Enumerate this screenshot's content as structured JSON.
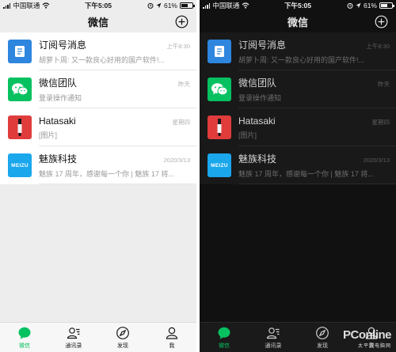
{
  "status": {
    "carrier": "中国联通",
    "time": "下午5:05",
    "battery": "61%",
    "battery_level": 0.61
  },
  "header": {
    "title": "微信"
  },
  "chats": [
    {
      "name": "订阅号消息",
      "preview": "胡萝卜周: 又一款良心好用的国产软件!...",
      "time": "上午8:30",
      "avatar": "subscription-icon",
      "color": "#2e86de"
    },
    {
      "name": "微信团队",
      "preview": "登录操作通知",
      "time": "昨天",
      "avatar": "wechat-icon",
      "color": "#07c160"
    },
    {
      "name": "Hatasaki",
      "preview": "[图片]",
      "time": "星期四",
      "avatar": "hatasaki-avatar",
      "color": "#e03c3c"
    },
    {
      "name": "魅族科技",
      "preview": "魅族 17 周年，感谢每一个你 | 魅族 17 将...",
      "time": "2020/3/13",
      "avatar": "meizu-logo",
      "logo_text": "MEIZU",
      "color": "#1aa7ec"
    }
  ],
  "tabs": [
    {
      "label": "微信",
      "icon": "chat-icon",
      "active": true
    },
    {
      "label": "通讯录",
      "icon": "contacts-icon"
    },
    {
      "label": "发现",
      "icon": "compass-icon"
    },
    {
      "label": "我",
      "icon": "profile-icon"
    }
  ],
  "watermark": {
    "logo": "PConline",
    "sub": "太平洋电脑网"
  },
  "colors": {
    "accent": "#07c160",
    "light_bg": "#ededed",
    "dark_bg": "#111111"
  }
}
